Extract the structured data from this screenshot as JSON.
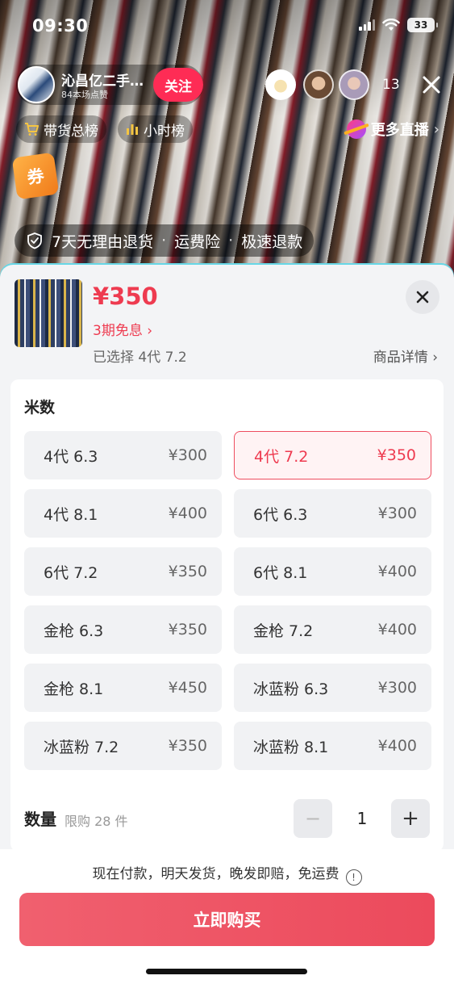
{
  "status_bar": {
    "time": "09:30",
    "battery": "33"
  },
  "live": {
    "host_name": "沁昌亿二手…",
    "host_sub": "84本场点赞",
    "follow_label": "关注",
    "viewer_count": "13",
    "chips": [
      "带货总榜",
      "小时榜"
    ],
    "more_live": "更多直播",
    "coupon": "券",
    "guarantee": [
      "7天无理由退货",
      "运费险",
      "极速退款"
    ]
  },
  "product": {
    "price": "¥350",
    "installment": "3期免息",
    "selected": "已选择 4代 7.2",
    "detail_link": "商品详情"
  },
  "spec": {
    "label": "米数",
    "options": [
      {
        "name": "4代 6.3",
        "price": "¥300",
        "selected": false
      },
      {
        "name": "4代 7.2",
        "price": "¥350",
        "selected": true
      },
      {
        "name": "4代 8.1",
        "price": "¥400",
        "selected": false
      },
      {
        "name": "6代 6.3",
        "price": "¥300",
        "selected": false
      },
      {
        "name": "6代 7.2",
        "price": "¥350",
        "selected": false
      },
      {
        "name": "6代 8.1",
        "price": "¥400",
        "selected": false
      },
      {
        "name": "金枪 6.3",
        "price": "¥350",
        "selected": false
      },
      {
        "name": "金枪 7.2",
        "price": "¥400",
        "selected": false
      },
      {
        "name": "金枪 8.1",
        "price": "¥450",
        "selected": false
      },
      {
        "name": "冰蓝粉 6.3",
        "price": "¥300",
        "selected": false
      },
      {
        "name": "冰蓝粉 7.2",
        "price": "¥350",
        "selected": false
      },
      {
        "name": "冰蓝粉 8.1",
        "price": "¥400",
        "selected": false
      }
    ]
  },
  "quantity": {
    "label": "数量",
    "limit": "限购 28 件",
    "value": "1",
    "minus": "−",
    "plus": "+"
  },
  "footer": {
    "shipping_note": "现在付款，明天发货，晚发即赔，免运费",
    "info_icon": "!",
    "buy_label": "立即购买"
  },
  "colors": {
    "accent": "#ee3b50",
    "follow": "#fe2c55"
  }
}
